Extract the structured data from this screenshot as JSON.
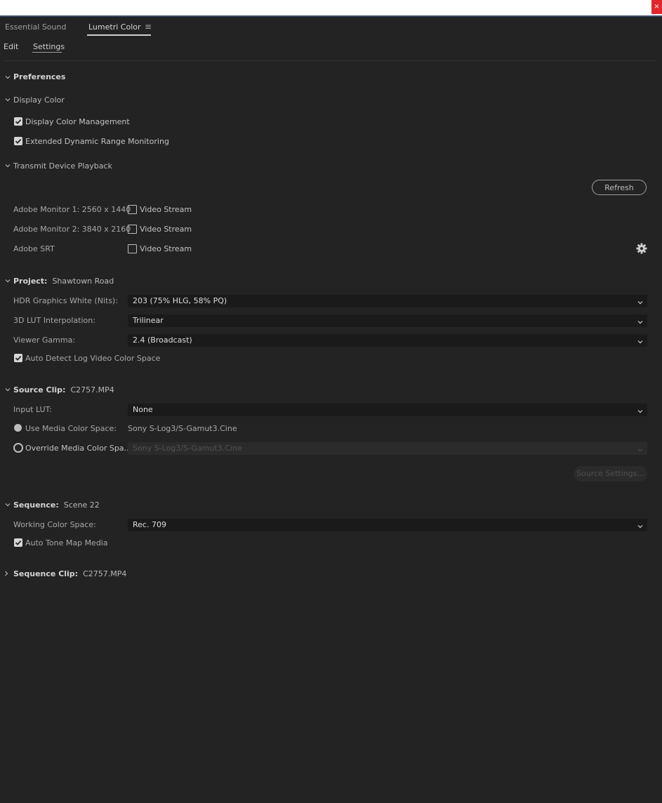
{
  "window": {
    "close_glyph": "×"
  },
  "panel_tabs": {
    "essential_sound": "Essential Sound",
    "lumetri_color": "Lumetri Color",
    "menu_glyph": "≡"
  },
  "subtabs": {
    "edit": "Edit",
    "settings": "Settings"
  },
  "preferences": {
    "title": "Preferences",
    "display_color": {
      "title": "Display Color",
      "display_color_management": {
        "label": "Display Color Management",
        "checked": true
      },
      "extended_dynamic_range": {
        "label": "Extended Dynamic Range Monitoring",
        "checked": true
      }
    },
    "transmit": {
      "title": "Transmit Device Playback",
      "refresh_label": "Refresh",
      "devices": [
        {
          "name": "Adobe Monitor 1: 2560 x 1440",
          "option": "Video Stream",
          "checked": false
        },
        {
          "name": "Adobe Monitor 2: 3840 x 2160",
          "option": "Video Stream",
          "checked": false
        },
        {
          "name": "Adobe SRT",
          "option": "Video Stream",
          "checked": false
        }
      ],
      "settings_icon": "gear-icon"
    }
  },
  "project": {
    "title": "Project:",
    "name": "Shawtown Road",
    "hdr_white": {
      "label": "HDR Graphics White (Nits):",
      "value": "203 (75% HLG, 58% PQ)"
    },
    "lut_interp": {
      "label": "3D LUT Interpolation:",
      "value": "Trilinear"
    },
    "viewer_gamma": {
      "label": "Viewer Gamma:",
      "value": "2.4 (Broadcast)"
    },
    "auto_detect_log": {
      "label": "Auto Detect Log Video Color Space",
      "checked": true
    }
  },
  "source_clip": {
    "title": "Source Clip:",
    "name": "C2757.MP4",
    "input_lut": {
      "label": "Input LUT:",
      "value": "None"
    },
    "use_media": {
      "label": "Use Media Color Space:",
      "value": "Sony S-Log3/S-Gamut3.Cine",
      "selected": true
    },
    "override_media": {
      "label": "Override Media Color Spa...",
      "value": "Sony S-Log3/S-Gamut3.Cine",
      "selected": false
    },
    "source_settings_label": "Source Settings..."
  },
  "sequence": {
    "title": "Sequence:",
    "name": "Scene 22",
    "working_space": {
      "label": "Working Color Space:",
      "value": "Rec. 709"
    },
    "auto_tone_map": {
      "label": "Auto Tone Map Media",
      "checked": true
    }
  },
  "sequence_clip": {
    "title": "Sequence Clip:",
    "name": "C2757.MP4"
  },
  "colors": {
    "background": "#232323",
    "select_bg": "#1a1a1a",
    "close": "#e2262b",
    "title_line": "#3d4d66"
  }
}
